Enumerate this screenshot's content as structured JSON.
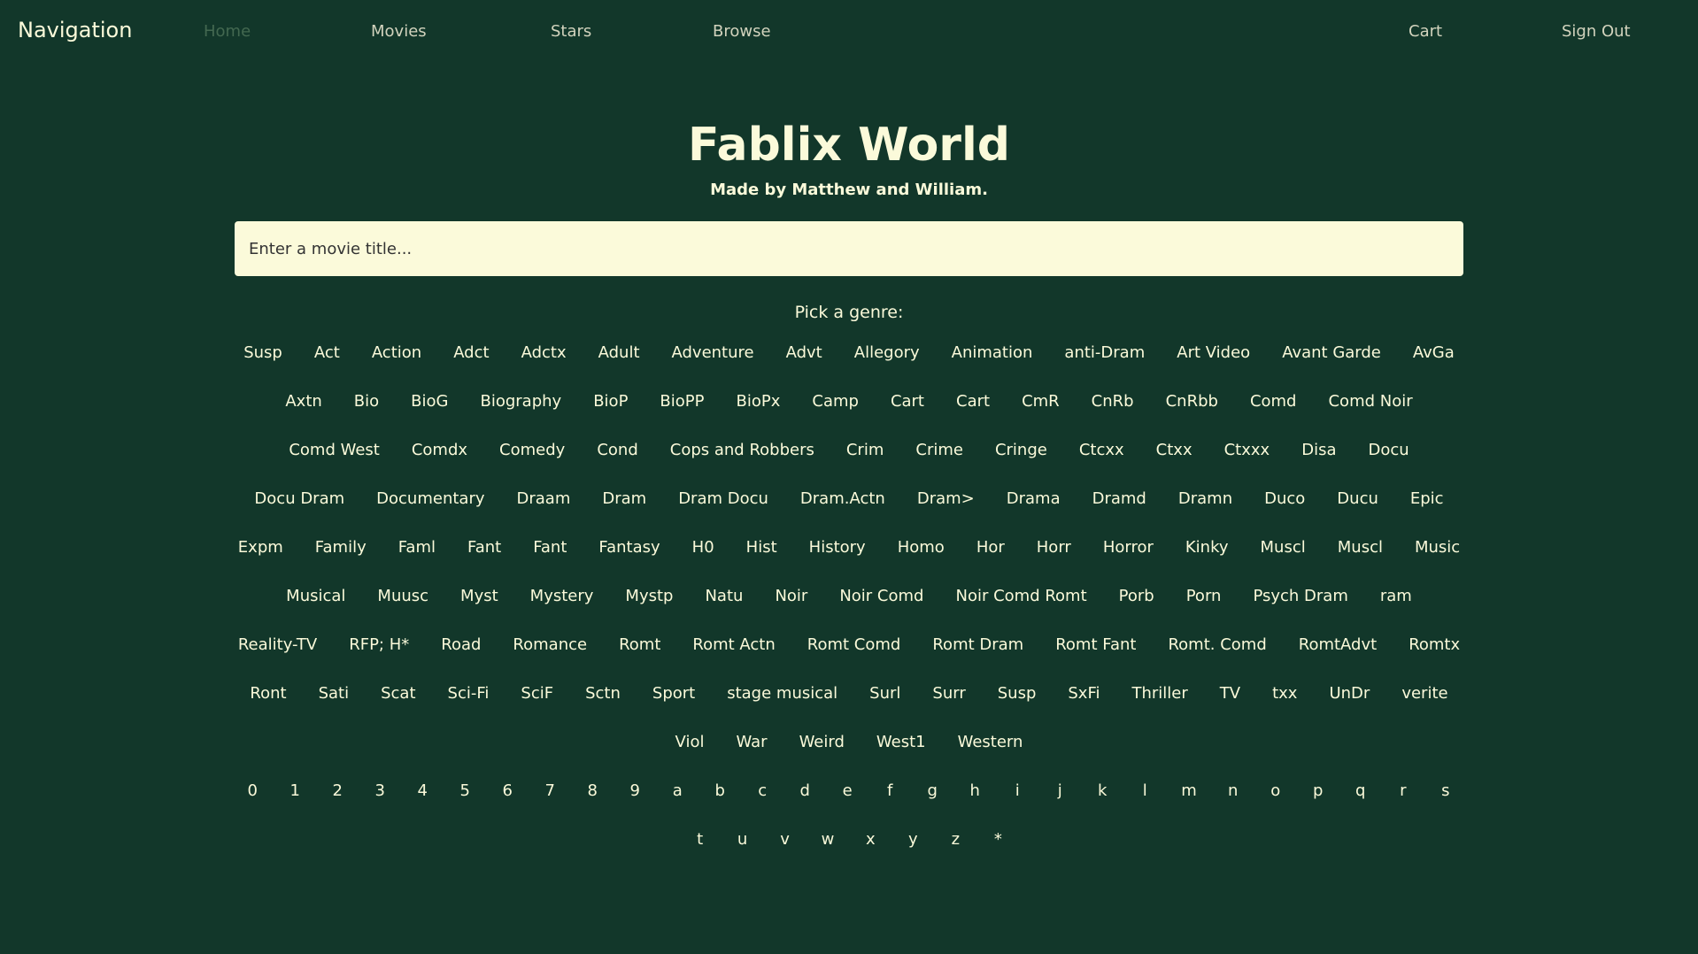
{
  "nav": {
    "brand": "Navigation",
    "links": [
      "Home",
      "Movies",
      "Stars",
      "Browse"
    ],
    "right_links": [
      "Cart",
      "Sign Out"
    ],
    "active": "Home"
  },
  "header": {
    "title": "Fablix World",
    "subtitle": "Made by Matthew and William."
  },
  "search": {
    "placeholder": "Enter a movie title..."
  },
  "genre_prompt": "Pick a genre:",
  "genres": [
    "Susp",
    "Act",
    "Action",
    "Adct",
    "Adctx",
    "Adult",
    "Adventure",
    "Advt",
    "Allegory",
    "Animation",
    "anti-Dram",
    "Art Video",
    "Avant Garde",
    "AvGa",
    "Axtn",
    "Bio",
    "BioG",
    "Biography",
    "BioP",
    "BioPP",
    "BioPx",
    "Camp",
    "Cart",
    "Cart",
    "CmR",
    "CnRb",
    "CnRbb",
    "Comd",
    "Comd Noir",
    "Comd West",
    "Comdx",
    "Comedy",
    "Cond",
    "Cops and Robbers",
    "Crim",
    "Crime",
    "Cringe",
    "Ctcxx",
    "Ctxx",
    "Ctxxx",
    "Disa",
    "Docu",
    "Docu Dram",
    "Documentary",
    "Draam",
    "Dram",
    "Dram Docu",
    "Dram.Actn",
    "Dram>",
    "Drama",
    "Dramd",
    "Dramn",
    "Duco",
    "Ducu",
    "Epic",
    "Expm",
    "Family",
    "Faml",
    "Fant",
    "Fant",
    "Fantasy",
    "H0",
    "Hist",
    "History",
    "Homo",
    "Hor",
    "Horr",
    "Horror",
    "Kinky",
    "Muscl",
    "Muscl",
    "Music",
    "Musical",
    "Muusc",
    "Myst",
    "Mystery",
    "Mystp",
    "Natu",
    "Noir",
    "Noir Comd",
    "Noir Comd Romt",
    "Porb",
    "Porn",
    "Psych Dram",
    "ram",
    "Reality-TV",
    "RFP; H*",
    "Road",
    "Romance",
    "Romt",
    "Romt Actn",
    "Romt Comd",
    "Romt Dram",
    "Romt Fant",
    "Romt. Comd",
    "RomtAdvt",
    "Romtx",
    "Ront",
    "Sati",
    "Scat",
    "Sci-Fi",
    "SciF",
    "Sctn",
    "Sport",
    "stage musical",
    "Surl",
    "Surr",
    "Susp",
    "SxFi",
    "Thriller",
    "TV",
    "txx",
    "UnDr",
    "verite",
    "Viol",
    "War",
    "Weird",
    "West1",
    "Western"
  ],
  "alpha": [
    "0",
    "1",
    "2",
    "3",
    "4",
    "5",
    "6",
    "7",
    "8",
    "9",
    "a",
    "b",
    "c",
    "d",
    "e",
    "f",
    "g",
    "h",
    "i",
    "j",
    "k",
    "l",
    "m",
    "n",
    "o",
    "p",
    "q",
    "r",
    "s",
    "t",
    "u",
    "v",
    "w",
    "x",
    "y",
    "z",
    "*"
  ],
  "colors": {
    "background": "#12372a",
    "text": "#fbfada",
    "nav_inactive": "#d2d3bd",
    "nav_active": "#436850",
    "input_bg": "#fbfada"
  }
}
